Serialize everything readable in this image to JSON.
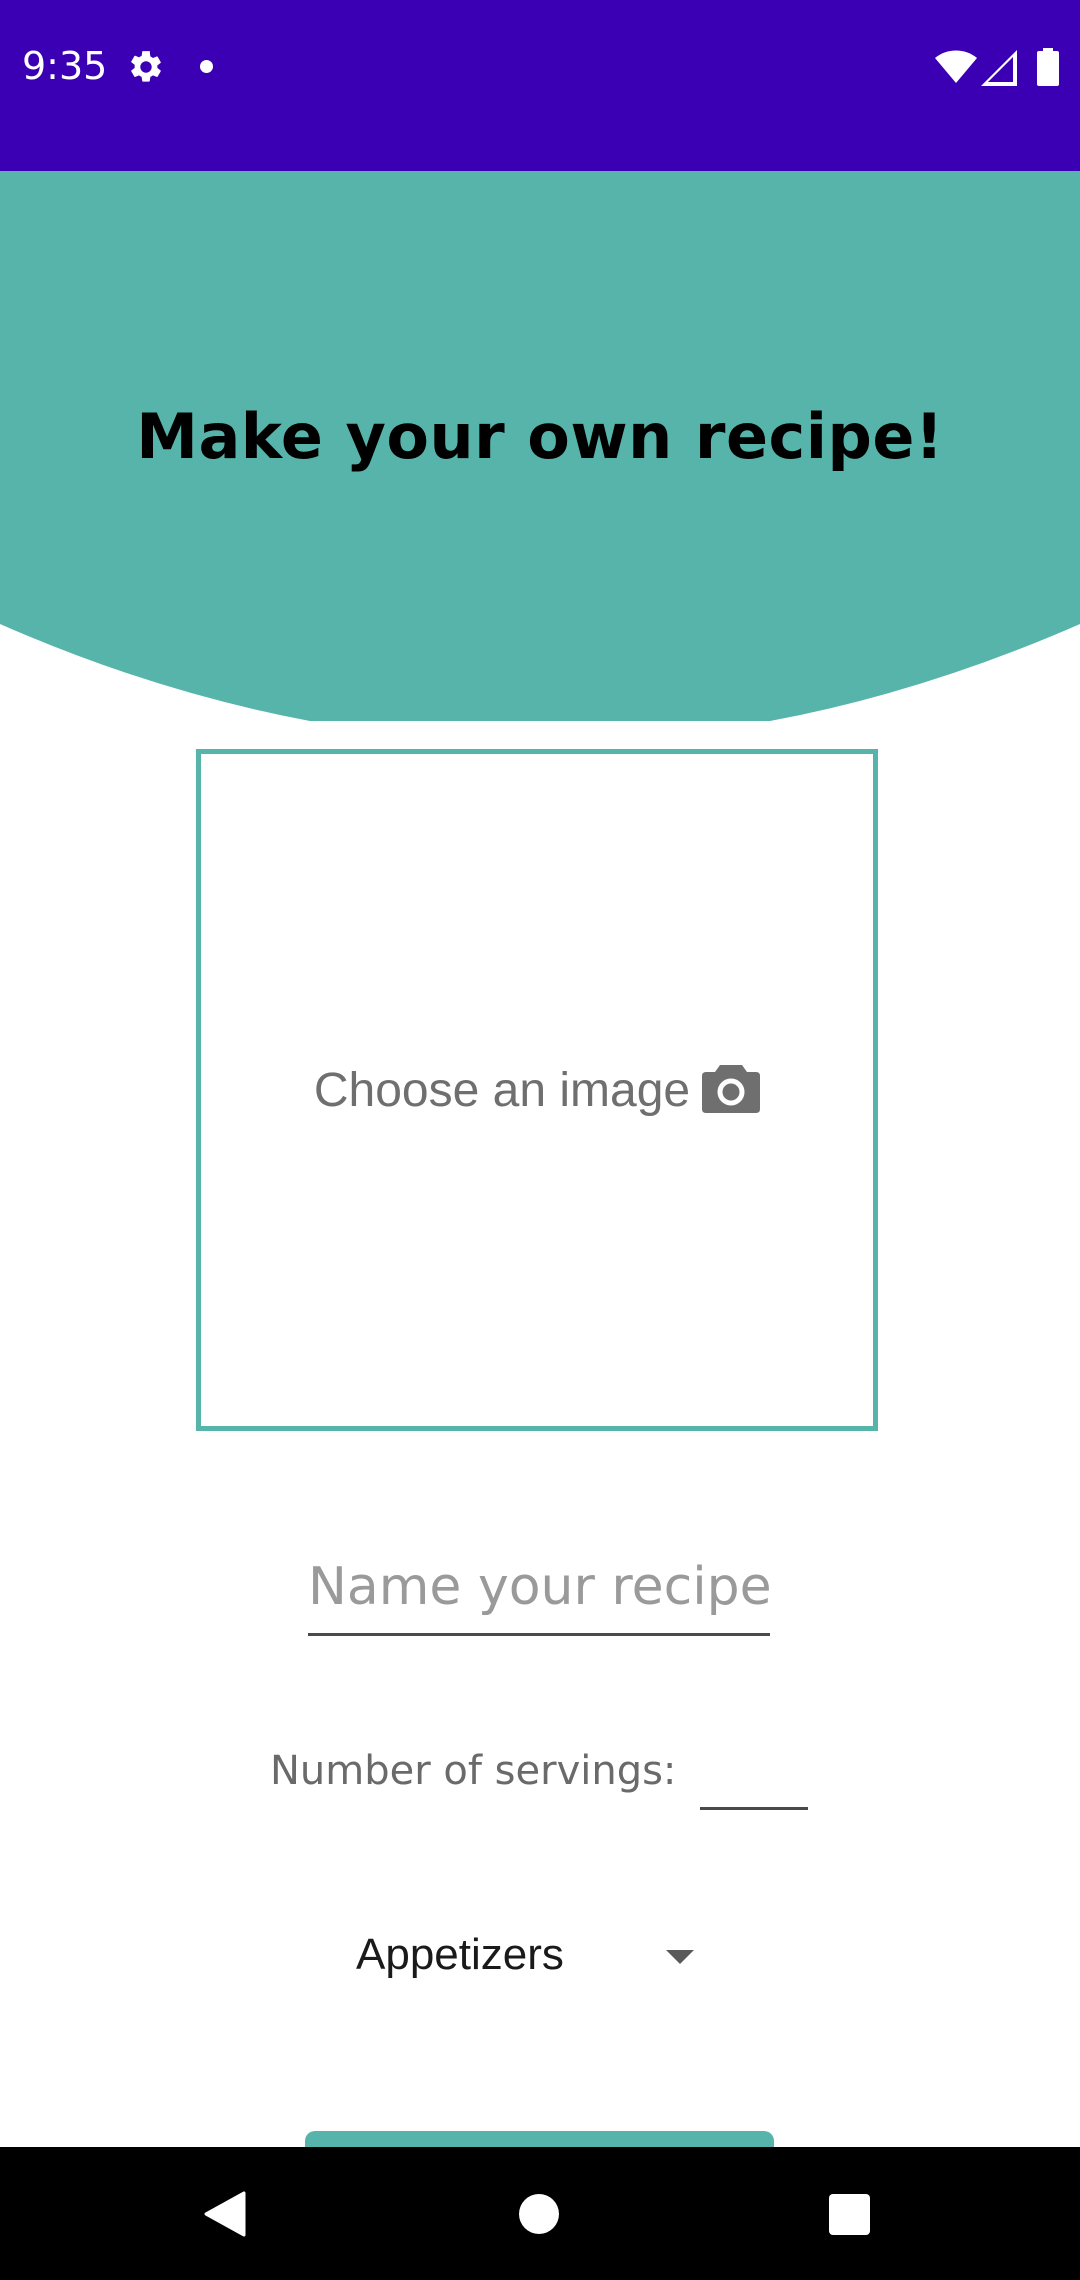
{
  "status_bar": {
    "time": "9:35",
    "icons": [
      "gear-icon",
      "notification-dot-icon",
      "wifi-icon",
      "signal-icon",
      "battery-icon"
    ],
    "background_color": "#3c00b4"
  },
  "header": {
    "title": "Make your own recipe!",
    "background_color": "#57b4aa"
  },
  "image_chooser": {
    "label": "Choose an image",
    "icon": "camera-icon",
    "border_color": "#57b4aa"
  },
  "recipe_name": {
    "placeholder": "Name your recipe!",
    "value": ""
  },
  "servings": {
    "label": "Number of servings:",
    "value": ""
  },
  "category": {
    "selected": "Appetizers",
    "icon": "dropdown-arrow-icon"
  },
  "submit_button": {
    "color": "#57b4aa"
  },
  "nav_bar": {
    "buttons": [
      "back-icon",
      "home-icon",
      "recents-icon"
    ]
  }
}
